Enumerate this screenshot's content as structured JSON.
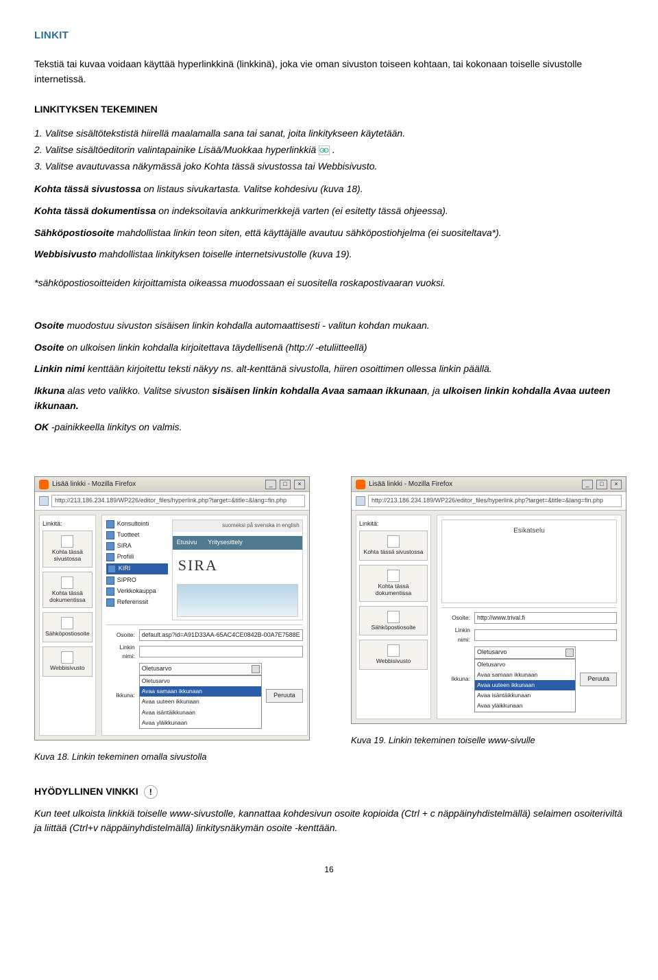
{
  "headings": {
    "h1": "LINKIT",
    "tekeminen": "LINKITYKSEN TEKEMINEN",
    "vinkki": "HYÖDYLLINEN VINKKI"
  },
  "intro": "Tekstiä tai kuvaa voidaan käyttää hyperlinkkinä (linkkinä), joka vie oman sivuston toiseen kohtaan, tai kokonaan toiselle sivustolle internetissä.",
  "steps": {
    "s1": "1. Valitse sisältötekstistä hiirellä maalamalla sana tai sanat, joita linkitykseen käytetään.",
    "s2a": "2. Valitse sisältöeditorin valintapainike Lisää/Muokkaa hyperlinkkiä ",
    "s2b": ".",
    "s3": "3. Valitse avautuvassa näkymässä joko Kohta tässä sivustossa tai Webbisivusto."
  },
  "desc": {
    "p1a": "Kohta tässä sivustossa",
    "p1b": " on listaus sivukartasta. Valitse kohdesivu (kuva 18).",
    "p2a": "Kohta tässä dokumentissa",
    "p2b": " on indeksoitavia ankkurimerkkejä varten (ei esitetty tässä ohjeessa).",
    "p3a": "Sähköpostiosoite",
    "p3b": " mahdollistaa linkin teon siten, että käyttäjälle avautuu sähköpostiohjelma (ei suositeltava*).",
    "p4a": "Webbisivusto",
    "p4b": " mahdollistaa linkityksen toiselle internetsivustolle (kuva 19).",
    "note": "*sähköpostiosoitteiden kirjoittamista oikeassa muodossaan ei suositella roskapostivaaran vuoksi."
  },
  "osoite": {
    "l1a": "Osoite",
    "l1b": " muodostuu sivuston sisäisen linkin kohdalla automaattisesti - valitun kohdan mukaan.",
    "l2a": "Osoite",
    "l2b": " on ulkoisen linkin kohdalla kirjoitettava täydellisenä (http:// -etuliitteellä)",
    "l3a": "Linkin nimi",
    "l3b": " kenttään kirjoitettu teksti näkyy ns. alt-kenttänä sivustolla, hiiren osoittimen ollessa linkin päällä.",
    "l4a": "Ikkuna",
    "l4b": " alas veto valikko. Valitse sivuston ",
    "l4c": "sisäisen linkin kohdalla Avaa samaan ikkunaan",
    "l4d": ", ja ",
    "l4e": "ulkoisen linkin kohdalla Avaa uuteen ikkunaan.",
    "l5a": "OK",
    "l5b": " -painikkeella linkitys on valmis."
  },
  "mock": {
    "title": "Lisää linkki - Mozilla Firefox",
    "url": "http://213.186.234.189/WP226/editor_files/hyperlink.php?target=&title=&lang=fin.php",
    "linkita": "Linkitä:",
    "side1": "Kohta tässä sivustossa",
    "side2": "Kohta tässä dokumentissa",
    "side3": "Sähköpostiosoite",
    "side4": "Webbisivusto",
    "tree": [
      "Konsultointi",
      "Tuotteet",
      "SIRA",
      "Profiili",
      "KIRI",
      "SIPRO",
      "Verkkokauppa",
      "Referenssit"
    ],
    "tabs": "suomeksi   på svenska   in english",
    "nav1": "Etusivu",
    "nav2": "Yritysesittely",
    "sira": "SIRA",
    "esik": "Esikatselu",
    "osoiteLabel": "Osoite:",
    "osoiteVal1": "default.asp?id=A91D33AA-65AC4CE0842B-00A7E7588E",
    "osoiteVal2": "http://www.trival.fi",
    "linkinNimi": "Linkin nimi:",
    "ikkuna": "Ikkuna:",
    "oletusarvo": "Oletusarvo",
    "peruuta": "Peruuta",
    "drop": [
      "Oletusarvo",
      "Avaa samaan ikkunaan",
      "Avaa uuteen ikkunaan",
      "Avaa isäntäikkunaan",
      "Avaa yläikkunaan"
    ]
  },
  "captions": {
    "c18": "Kuva 18. Linkin tekeminen omalla sivustolla",
    "c19": "Kuva 19. Linkin tekeminen toiselle www-sivulle"
  },
  "vinkki": "Kun teet ulkoista linkkiä toiselle www-sivustolle, kannattaa kohdesivun osoite kopioida  (Ctrl + c näppäinyhdistelmällä) selaimen osoiteriviltä ja liittää (Ctrl+v näppäinyhdistelmällä) linkitysnäkymän osoite -kenttään.",
  "pageNum": "16"
}
